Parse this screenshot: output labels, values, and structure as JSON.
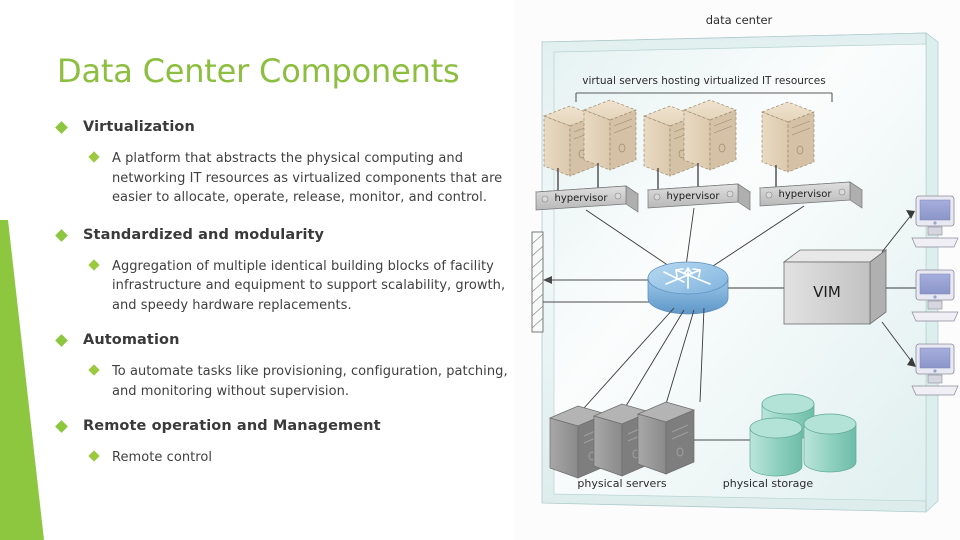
{
  "slide": {
    "title": "Data Center Components",
    "accent_color": "#8DC63F",
    "title_color": "#8CBE3F"
  },
  "content": {
    "sections": [
      {
        "heading": "Virtualization",
        "detail": "A platform that abstracts the physical computing and networking IT resources as virtualized components that are easier to allocate, operate, release, monitor, and control."
      },
      {
        "heading": "Standardized and modularity",
        "detail": "Aggregation of multiple identical building blocks of facility infrastructure and equipment to support scalability, growth, and speedy hardware replacements."
      },
      {
        "heading": "Automation",
        "detail": "To automate tasks like provisioning, configuration, patching, and monitoring without supervision."
      },
      {
        "heading": "Remote operation and Management",
        "detail": "Remote control"
      }
    ]
  },
  "diagram": {
    "title": "data center",
    "virtual_servers_label": "virtual servers hosting virtualized IT resources",
    "hypervisors": [
      "hypervisor",
      "hypervisor",
      "hypervisor"
    ],
    "vim_label": "VIM",
    "physical_servers_label": "physical servers",
    "physical_storage_label": "physical storage",
    "colors": {
      "box_fill": "#E6F0F0",
      "server_fill": "#E3D3BB",
      "hypervisor_fill": "#C8C8C8",
      "router_fill": "#7FB4DC",
      "vim_fill": "#D0D0D0",
      "physical_server_fill": "#9A9A9A",
      "storage_fill": "#8FCFC0",
      "workstation_fill": "#9AA3D0"
    }
  }
}
